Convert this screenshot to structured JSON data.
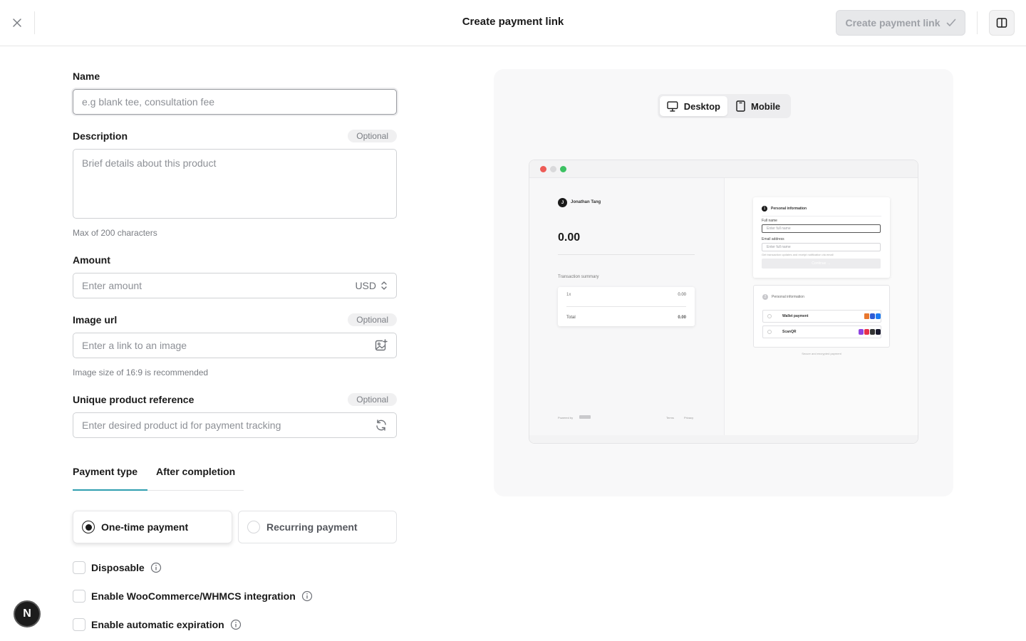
{
  "header": {
    "title": "Create payment link",
    "create_button": "Create payment link"
  },
  "form": {
    "name": {
      "label": "Name",
      "placeholder": "e.g blank tee, consultation fee"
    },
    "description": {
      "label": "Description",
      "optional": "Optional",
      "placeholder": "Brief details about this product",
      "hint": "Max of 200 characters"
    },
    "amount": {
      "label": "Amount",
      "placeholder": "Enter amount",
      "currency": "USD"
    },
    "image_url": {
      "label": "Image url",
      "optional": "Optional",
      "placeholder": "Enter a link to an image",
      "hint": "Image size of 16:9 is recommended"
    },
    "reference": {
      "label": "Unique product reference",
      "optional": "Optional",
      "placeholder": "Enter desired product id for payment tracking"
    },
    "tabs": [
      {
        "label": "Payment type"
      },
      {
        "label": "After completion"
      }
    ],
    "payment_types": [
      {
        "label": "One-time payment",
        "selected": true
      },
      {
        "label": "Recurring payment",
        "selected": false
      }
    ],
    "checkboxes": [
      {
        "label": "Disposable"
      },
      {
        "label": "Enable WooCommerce/WHMCS integration"
      },
      {
        "label": "Enable automatic expiration"
      }
    ]
  },
  "preview": {
    "devices": [
      {
        "label": "Desktop"
      },
      {
        "label": "Mobile"
      }
    ],
    "merchant_initial": "J",
    "merchant_name": "Jonathan Tang",
    "amount": "0.00",
    "summary_title": "Transaction summary",
    "summary_qty": "1x",
    "summary_qty_value": "0.00",
    "summary_total_label": "Total",
    "summary_total_value": "0.00",
    "powered_by": "Powered by",
    "footer_links": [
      "Terms",
      "Privacy"
    ],
    "step1": {
      "num": "1",
      "title": "Personal information",
      "full_name_label": "Full name",
      "full_name_placeholder": "Enter full name",
      "email_label": "Email address",
      "email_placeholder": "Enter full name",
      "email_hint": "Get transaction updates and receipt notification via email",
      "continue": "Continue →"
    },
    "step2": {
      "num": "2",
      "title": "Personal information",
      "options": [
        {
          "label": "Wallet payment"
        },
        {
          "label": "ScanQR"
        }
      ]
    },
    "secure_note": "Secure and encrypted payment"
  },
  "avatar_initial": "N",
  "colors": {
    "accent": "#2f9fb0",
    "disabled_button": "#e7e8ea",
    "dot_red": "#ed5b56",
    "dot_gray": "#d9d9db",
    "dot_green": "#3cc162"
  }
}
